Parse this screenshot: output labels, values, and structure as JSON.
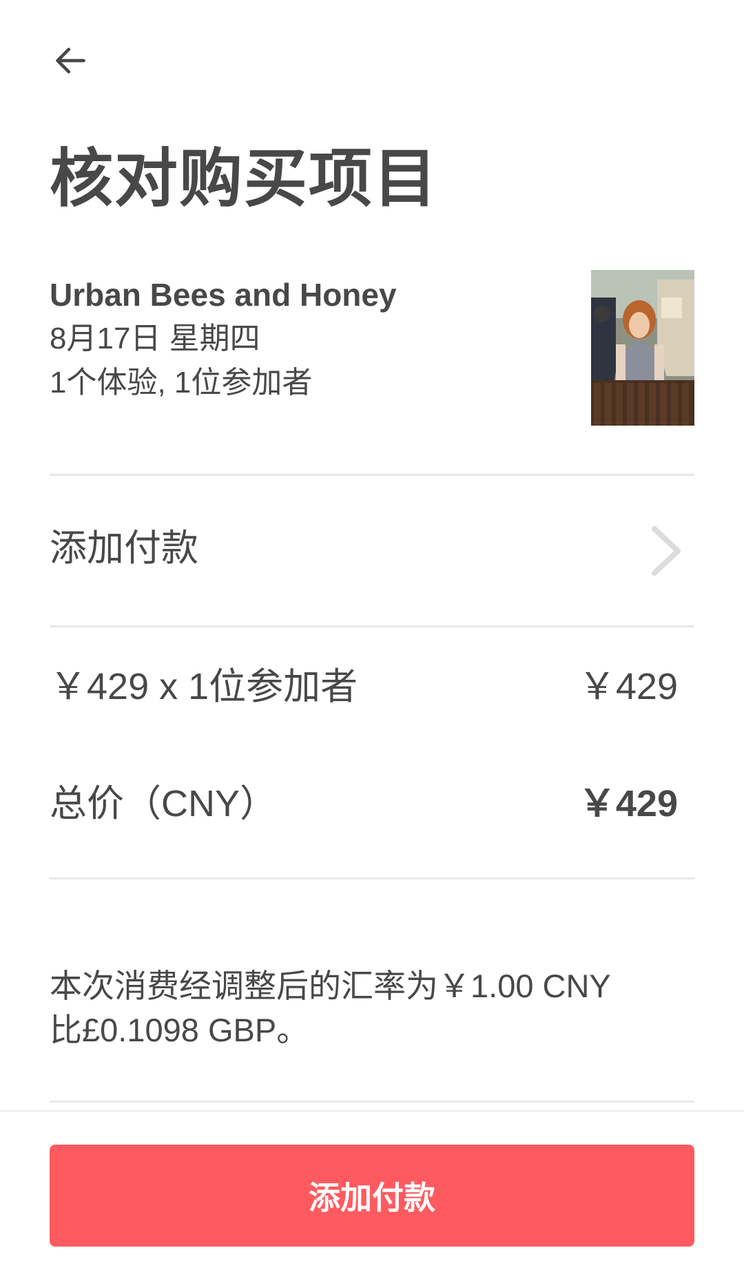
{
  "header": {
    "back_icon": "arrow-left-icon",
    "title": "核对购买项目"
  },
  "listing": {
    "name": "Urban Bees and Honey",
    "date": "8月17日 星期四",
    "guests": "1个体验, 1位参加者",
    "photo_icon": "host-photo"
  },
  "payment": {
    "label": "添加付款",
    "chevron_icon": "chevron-right-icon"
  },
  "pricing": {
    "line_label": "￥429 x 1位参加者",
    "line_amount": "￥429",
    "total_label": "总价（CNY）",
    "total_amount": "￥429"
  },
  "note": {
    "line1": "本次消费经调整后的汇率为￥1.00 CNY",
    "line2": "比£0.1098 GBP。"
  },
  "footer": {
    "button_label": "添加付款"
  },
  "colors": {
    "accent": "#ff5a5f",
    "text": "#484848",
    "divider": "#e9e9e9"
  }
}
